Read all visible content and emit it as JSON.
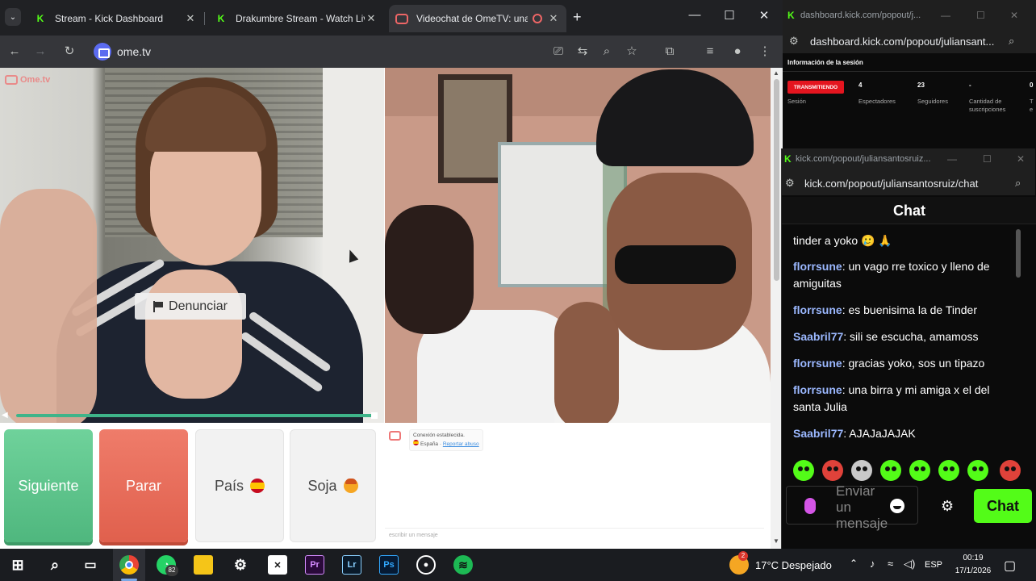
{
  "browser": {
    "tabs": [
      {
        "title": "Stream - Kick Dashboard",
        "icon": "kick-icon",
        "active": false
      },
      {
        "title": "Drakumbre Stream - Watch Live",
        "icon": "kick-icon",
        "active": false
      },
      {
        "title": "Videochat de OmeTV: una alternativa",
        "icon": "ometv-icon",
        "active": true
      }
    ],
    "address": "ome.tv"
  },
  "ometv": {
    "logo": "Ome.tv",
    "report_label": "Denunciar",
    "volume_level": 1.0,
    "buttons": {
      "next": "Siguiente",
      "stop": "Parar",
      "country": "País",
      "gender": "Soja"
    },
    "system_message": {
      "line1": "Conexión establecida.",
      "country": "España",
      "report_link": "Reportar abuso"
    },
    "message_placeholder": "escribir un mensaje"
  },
  "dashboard_popout": {
    "window_title": "dashboard.kick.com/popout/j...",
    "url": "dashboard.kick.com/popout/juliansant...",
    "section_title": "Información de la sesión",
    "live_badge": "TRANSMITIENDO",
    "session_label": "Sesión",
    "stats": [
      {
        "value": "4",
        "label": "Espectadores"
      },
      {
        "value": "23",
        "label": "Seguidores"
      },
      {
        "value": "-",
        "label": "Cantidad de suscripciones"
      },
      {
        "value": "0",
        "label": "T e"
      }
    ]
  },
  "chat_popout": {
    "window_title": "kick.com/popout/juliansantosruiz...",
    "url": "kick.com/popout/juliansantosruiz/chat",
    "header": "Chat",
    "messages": [
      {
        "user": "",
        "text": "tinder a yoko 🥲 🙏"
      },
      {
        "user": "florrsune",
        "text": ": un vago rre toxico y lleno de amiguitas"
      },
      {
        "user": "florrsune",
        "text": ": es buenisima la de Tinder"
      },
      {
        "user": "Saabril77",
        "text": ": sili se escucha, amamoss"
      },
      {
        "user": "florrsune",
        "text": ": gracias yoko, sos un tipazo"
      },
      {
        "user": "florrsune",
        "text": ": una birra y mi amiga x el del santa Julia"
      },
      {
        "user": "Saabril77",
        "text": ": AJAJaJAJAK"
      }
    ],
    "input_placeholder": "Enviar un mensaje",
    "send_label": "Chat"
  },
  "taskbar": {
    "weather": "17°C  Despejado",
    "weather_badge": "2",
    "language": "ESP",
    "time": "00:19",
    "date": "17/1/2026",
    "whatsapp_badge": "82"
  },
  "colors": {
    "kick_green": "#53fc18",
    "next_green": "#4fb77e",
    "stop_red": "#e0604d",
    "live_red": "#e4151f",
    "chat_user": "#9bb8ff"
  }
}
